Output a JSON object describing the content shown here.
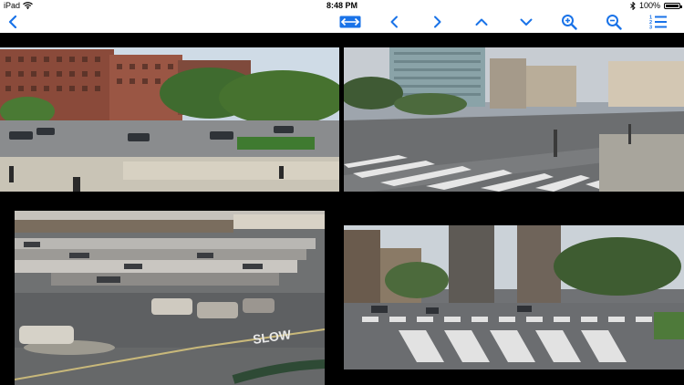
{
  "status_bar": {
    "device": "iPad",
    "wifi_icon": "wifi-icon",
    "time": "8:48 PM",
    "bluetooth_icon": "bluetooth-icon",
    "battery_percent": "100%",
    "battery_level": 1.0
  },
  "toolbar": {
    "accent_color": "#1a73e8",
    "buttons": [
      {
        "name": "back-button",
        "icon": "chevron-left-icon"
      },
      {
        "name": "fit-width-button",
        "icon": "fit-width-icon"
      },
      {
        "name": "previous-button",
        "icon": "chevron-left-icon"
      },
      {
        "name": "next-button",
        "icon": "chevron-right-icon"
      },
      {
        "name": "page-up-button",
        "icon": "chevron-up-icon"
      },
      {
        "name": "page-down-button",
        "icon": "chevron-down-icon"
      },
      {
        "name": "zoom-in-button",
        "icon": "zoom-in-icon"
      },
      {
        "name": "zoom-out-button",
        "icon": "zoom-out-icon"
      },
      {
        "name": "layout-list-button",
        "icon": "numbered-list-icon"
      }
    ],
    "layout_list_digits": [
      "1",
      "2",
      "3"
    ]
  },
  "feeds": [
    {
      "name": "camera-feed-1",
      "scene": "street intersection with brick apartment buildings"
    },
    {
      "name": "camera-feed-2",
      "scene": "wide crosswalk with high-rise buildings"
    },
    {
      "name": "camera-feed-3",
      "scene": "parking lot",
      "painted_text": "SLOW"
    },
    {
      "name": "camera-feed-4",
      "scene": "avenue crosswalk with tall buildings and trees"
    }
  ]
}
